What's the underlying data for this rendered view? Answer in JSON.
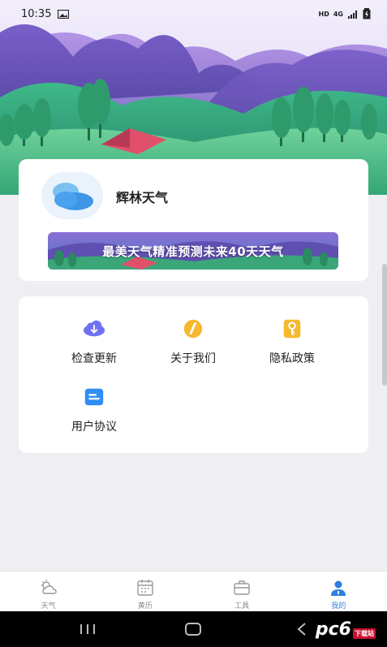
{
  "status_bar": {
    "time": "10:35",
    "indicators": [
      "HD",
      "4G"
    ]
  },
  "profile": {
    "app_name": "辉林天气",
    "avatar_icon": "cloud-icon",
    "banner_text": "最美天气精准预测未来40天天气"
  },
  "menu": {
    "items": [
      {
        "label": "检查更新",
        "icon": "cloud-download-icon",
        "color": "#6f72f0"
      },
      {
        "label": "关于我们",
        "icon": "info-icon",
        "color": "#f5b82e"
      },
      {
        "label": "隐私政策",
        "icon": "key-icon",
        "color": "#f5b82e"
      },
      {
        "label": "用户协议",
        "icon": "document-icon",
        "color": "#2f8df5"
      }
    ]
  },
  "tabbar": {
    "tabs": [
      {
        "label": "天气",
        "icon": "weather-icon",
        "active": false
      },
      {
        "label": "黄历",
        "icon": "calendar-icon",
        "active": false
      },
      {
        "label": "工具",
        "icon": "toolbox-icon",
        "active": false
      },
      {
        "label": "我的",
        "icon": "user-icon",
        "active": true
      }
    ]
  },
  "watermark": {
    "text": "pc6",
    "sub": "下载站"
  },
  "colors": {
    "accent": "#2d7fe0",
    "background": "#efeff3"
  }
}
